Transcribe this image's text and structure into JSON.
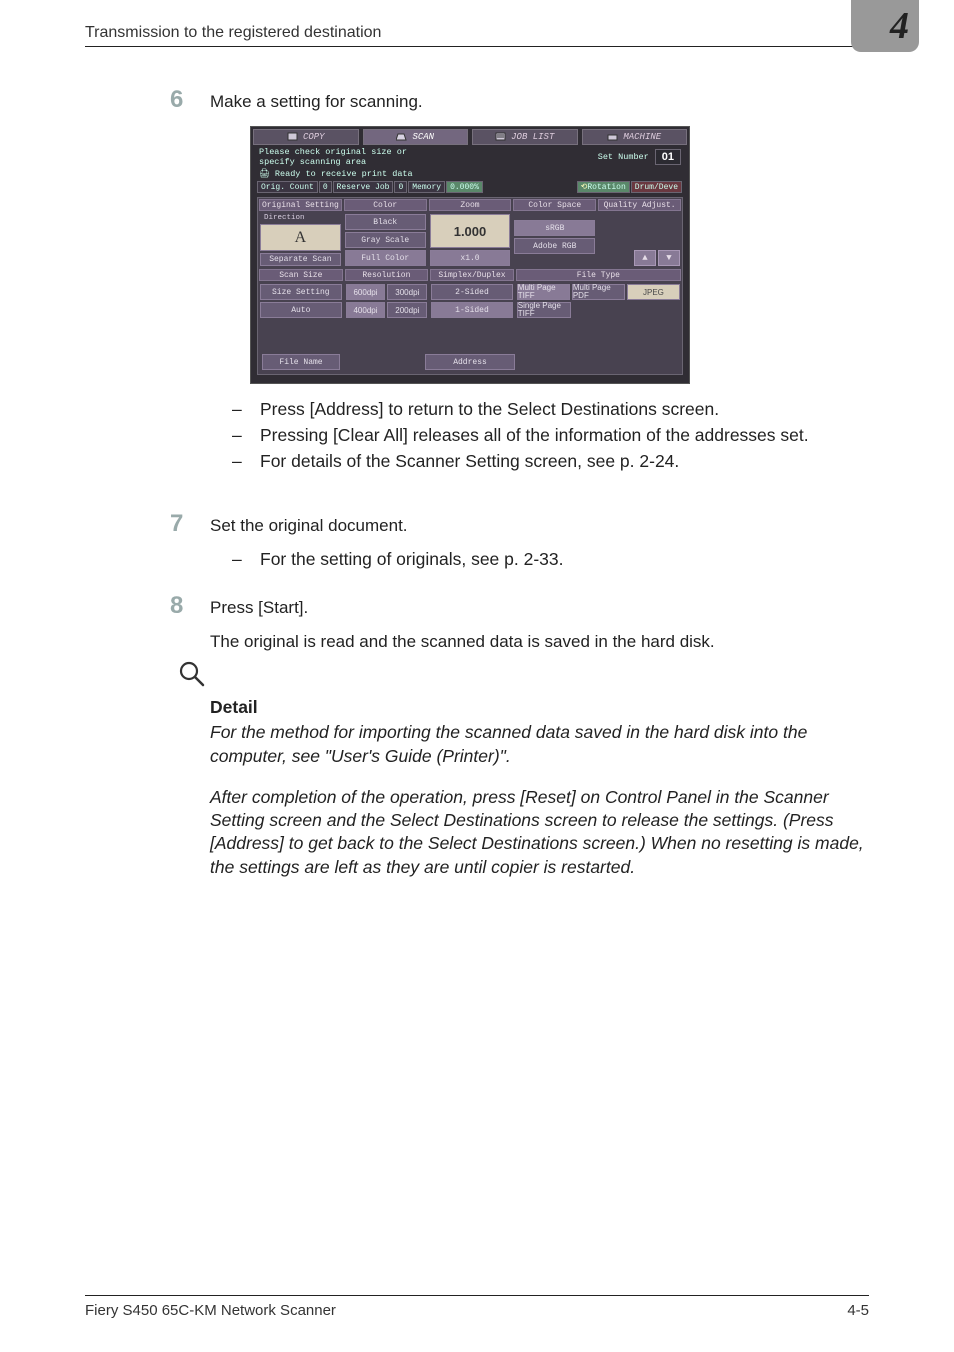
{
  "header": {
    "title": "Transmission to the registered destination",
    "chapter": "4"
  },
  "footer": {
    "left": "Fiery S450 65C-KM Network Scanner",
    "right": "4-5"
  },
  "steps": {
    "s6": {
      "num": "6",
      "text": "Make a setting for scanning."
    },
    "s7": {
      "num": "7",
      "text": "Set the original document."
    },
    "s8": {
      "num": "8",
      "text": "Press [Start]."
    },
    "s8result": "The original is read and the scanned data is saved in the hard disk."
  },
  "bullets6": [
    "Press [Address] to return to the Select Destinations screen.",
    "Pressing [Clear All] releases all of the information of the addresses set.",
    "For details of the Scanner Setting screen, see p. 2-24."
  ],
  "bullets7": [
    "For the setting of originals, see p. 2-33."
  ],
  "detail": {
    "heading": "Detail",
    "p1": "For the method for importing the scanned data saved in the hard disk into the computer, see \"User's Guide (Printer)\".",
    "p2": "After completion of the operation, press [Reset] on Control Panel in the Scanner Setting screen and the Select Destinations screen to release the settings. (Press [Address] to get back to the Select Destinations screen.) When no resetting is made, the settings are left as they are until copier is restarted."
  },
  "scr": {
    "tabs": {
      "copy": "COPY",
      "scan": "SCAN",
      "joblist": "JOB LIST",
      "machine": "MACHINE"
    },
    "msg1": "Please check original size or",
    "msg2": "specify scanning area",
    "setnum_label": "Set Number",
    "setnum_val": "01",
    "printer_msg": "Ready to receive print data",
    "status": {
      "orig": "Orig. Count",
      "origv": "0",
      "res": "Reserve Job",
      "resv": "0",
      "mem": "Memory",
      "memv": "0.000%",
      "rot": "Rotation",
      "drum": "Drum/Deve"
    },
    "hdr": {
      "orig": "Original Setting",
      "color": "Color",
      "zoom": "Zoom",
      "cspace": "Color Space",
      "qual": "Quality Adjust."
    },
    "direction_label": "Direction",
    "direction_A": "A",
    "separate": "Separate Scan",
    "colorbtns": {
      "black": "Black",
      "gray": "Gray Scale",
      "full": "Full Color"
    },
    "zoomval": "1.000",
    "zoomx": "x1.0",
    "cspacebtns": {
      "srgb": "sRGB",
      "adobe": "Adobe RGB"
    },
    "arrows": {
      "up": "▲",
      "down": "▼"
    },
    "row3": {
      "scansize": "Scan Size",
      "resolution": "Resolution",
      "simdup": "Simplex/Duplex",
      "filetype": "File Type"
    },
    "sizebtns": {
      "setting": "Size Setting",
      "auto": "Auto"
    },
    "resbtns": {
      "r600": "600dpi",
      "r300": "300dpi",
      "r400": "400dpi",
      "r200": "200dpi"
    },
    "dupbtns": {
      "two": "2-Sided",
      "one": "1-Sided"
    },
    "ftbtns": {
      "mptiff": "Multi Page TIFF",
      "mppdf": "Multi Page PDF",
      "jpeg": "JPEG",
      "sptiff": "Single Page TIFF"
    },
    "filename": "File Name",
    "address": "Address"
  },
  "chart_data": null
}
